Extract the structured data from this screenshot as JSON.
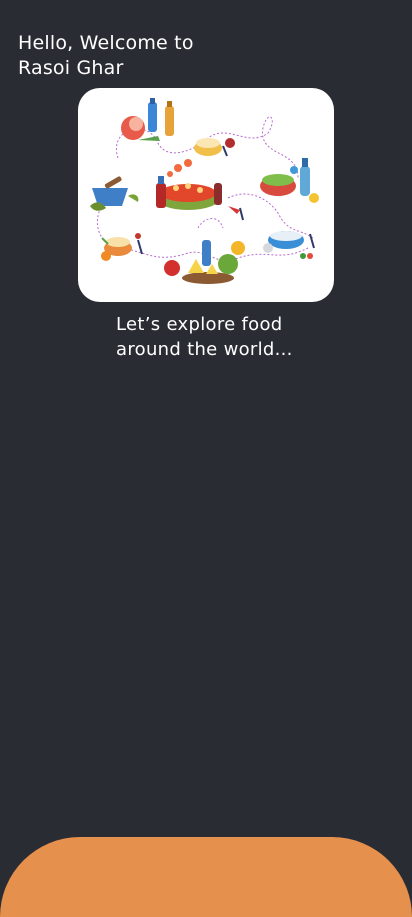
{
  "header": {
    "greeting_line1": "Hello, Welcome to",
    "greeting_line2": "Rasoi Ghar"
  },
  "hero": {
    "illustration": "food-world-illustration"
  },
  "tagline": {
    "line1": "Let’s explore food",
    "line2": "around the world..."
  },
  "colors": {
    "background": "#2a2c34",
    "card": "#ffffff",
    "accent": "#e6904e",
    "text": "#ffffff"
  }
}
